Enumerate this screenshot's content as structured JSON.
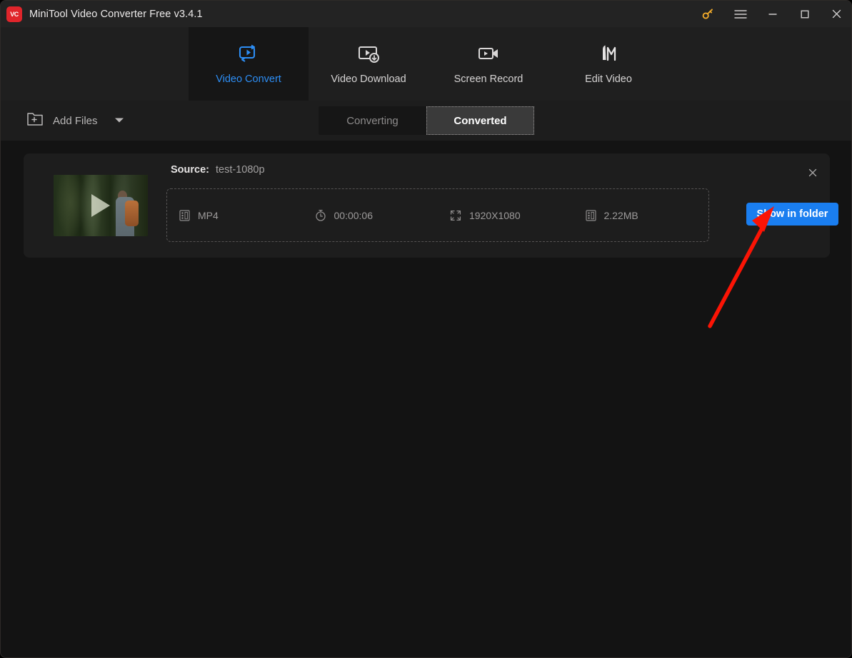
{
  "window": {
    "title": "MiniTool Video Converter Free v3.4.1",
    "logo_text": "VC",
    "logo_color": "#e0252b",
    "controls": [
      {
        "name": "key-icon",
        "label": "Activate"
      },
      {
        "name": "hamburger-menu-icon",
        "label": "Menu"
      },
      {
        "name": "minimize-icon",
        "label": "Minimize"
      },
      {
        "name": "maximize-icon",
        "label": "Maximize"
      },
      {
        "name": "close-icon",
        "label": "Close"
      }
    ]
  },
  "nav": {
    "active_color": "#2d8ef5",
    "tabs": [
      {
        "label": "Video Convert",
        "icon": "video-convert-icon",
        "active": true
      },
      {
        "label": "Video Download",
        "icon": "video-download-icon",
        "active": false
      },
      {
        "label": "Screen Record",
        "icon": "screen-record-icon",
        "active": false
      },
      {
        "label": "Edit Video",
        "icon": "edit-video-icon",
        "active": false
      }
    ]
  },
  "toolbar": {
    "add_files_label": "Add Files",
    "add_files_icon": "folder-plus-icon",
    "dropdown_icon": "chevron-down-icon",
    "switch": {
      "converting_label": "Converting",
      "converted_label": "Converted",
      "selected": "Converted"
    }
  },
  "file_card": {
    "source_label": "Source:",
    "source_value": "test-1080p",
    "close_icon": "close-icon",
    "thumbnail_play_icon": "play-icon",
    "meta": [
      {
        "icon": "film-strip-icon",
        "value": "MP4"
      },
      {
        "icon": "stopwatch-icon",
        "value": "00:00:06"
      },
      {
        "icon": "resolution-icon",
        "value": "1920X1080"
      },
      {
        "icon": "file-size-icon",
        "value": "2.22MB"
      }
    ],
    "action_button": {
      "label": "Show in folder",
      "color": "#1a7ef0"
    }
  },
  "annotation": {
    "arrow_color": "#fb1405",
    "points_to": "Show in folder"
  }
}
